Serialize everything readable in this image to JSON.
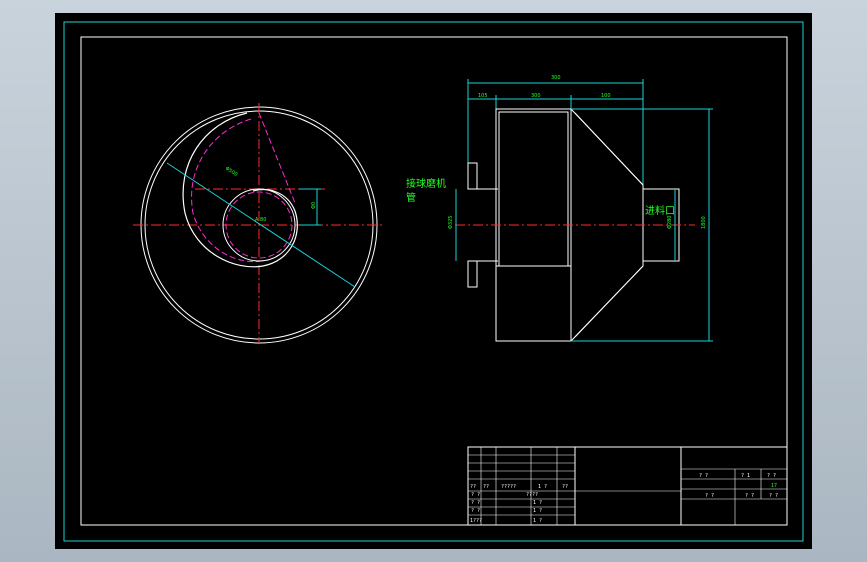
{
  "drawing": {
    "dims": {
      "overall_width": "300",
      "flange_width": "105",
      "body_width": "300",
      "cone_width": "100",
      "height_total": "1800",
      "shaft_dia": "Φ325",
      "inlet_dia": "Φ280",
      "vertical_offset": "Φ0",
      "radial": "Φ500",
      "circle_label": "A 80"
    },
    "labels": {
      "fan_connection_line1": "接球磨机",
      "fan_connection_line2": "管",
      "feed_inlet": "进料口"
    }
  },
  "title_block": {
    "left_rows": [
      {
        "c1": "??",
        "c2": "??",
        "c3": "?????",
        "c4": "1 ?",
        "c5": "??"
      },
      {
        "c1": "? ?",
        "c2": "",
        "c3": "????",
        "c4": "",
        "c5": ""
      },
      {
        "c1": "? ?",
        "c2": "",
        "c3": "",
        "c4": "1 ?",
        "c5": ""
      },
      {
        "c1": "? ?",
        "c2": "",
        "c3": "",
        "c4": "1 ?",
        "c5": ""
      },
      {
        "c1": "1???",
        "c2": "",
        "c3": "",
        "c4": "1 ?",
        "c5": ""
      }
    ],
    "right": {
      "r1c1": "? ?",
      "r1c2": "? 1",
      "r1c3": "? ?",
      "sheet": "17",
      "r3c1": "? ?",
      "r3c2": "? ?",
      "r3c3": "? ?"
    }
  }
}
